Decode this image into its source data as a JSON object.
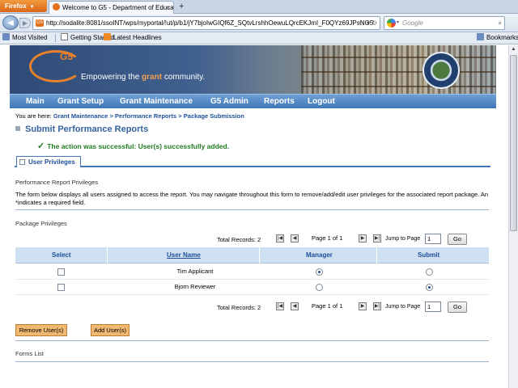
{
  "browser": {
    "menu_label": "Firefox",
    "tab_title": "Welcome to G5 - Department of Educati...",
    "tab_close": "×",
    "new_tab": "+",
    "url": "http://sodalite:8081/ssoINT/wps/myportal/!ut/p/b1/jY7bjoIwGIQf6Z_SQtvLrshhOewuLQrcEKJmI_F0QYz69JPsNG5",
    "url_badge": "G5",
    "search_placeholder": "Google",
    "bookmarks": [
      "Most Visited",
      "Getting Started",
      "Latest Headlines"
    ],
    "bookmarks_right": "Bookmarks"
  },
  "banner": {
    "logo_text": "G5",
    "tagline_pre": "Empowering the ",
    "tagline_accent": "grant",
    "tagline_post": " community."
  },
  "nav": [
    "Main",
    "Grant Setup",
    "Grant Maintenance",
    "G5 Admin",
    "Reports",
    "Logout"
  ],
  "breadcrumb": {
    "prefix": "You are here: ",
    "items": [
      "Grant Maintenance",
      "Performance Reports",
      "Package Submission"
    ],
    "separator": " > "
  },
  "page_title": "Submit Performance Reports",
  "success_message": "The action was successful: User(s) successfully added.",
  "active_tab": "User Privileges",
  "sections": {
    "perf_privileges": "Performance Report Privileges",
    "description": "The form below displays all users assigned to access the report. You may navigate throughout this form to remove/add/edit user privileges for the associated report package.  An *indicates a required field.",
    "package_privileges": "Package Privileges",
    "forms_list": "Forms List"
  },
  "pager": {
    "total_label": "Total Records:",
    "total": "2",
    "first": "|◀",
    "prev": "◀",
    "page_text": "Page 1 of 1",
    "next": "▶",
    "last": "▶|",
    "jump_label": "Jump to Page",
    "jump_value": "1",
    "go_label": "Go"
  },
  "table": {
    "headers": {
      "select": "Select",
      "user_name": "User Name",
      "manager": "Manager",
      "submit": "Submit"
    },
    "rows": [
      {
        "name": "Tim Applicant",
        "selected": false,
        "manager": true,
        "submit": false
      },
      {
        "name": "Bjorn Reviewer",
        "selected": false,
        "manager": false,
        "submit": true
      }
    ]
  },
  "buttons": {
    "remove": "Remove User(s)",
    "add": "Add User(s)"
  },
  "colors": {
    "nav_blue": "#3f77b8",
    "title_blue": "#35639f",
    "success_green": "#1f7a1f",
    "button_orange": "#f0b870",
    "header_blue": "#cfe0f3"
  }
}
